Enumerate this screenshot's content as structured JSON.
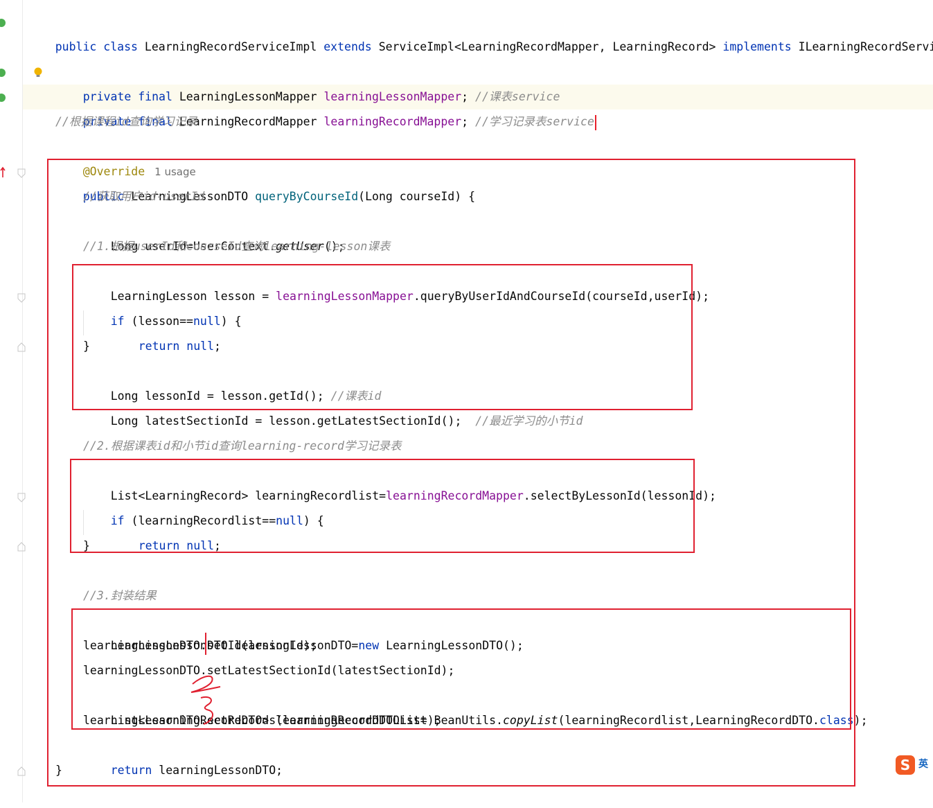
{
  "editor": {
    "class_decl": {
      "public": "public",
      "class": "class",
      "name": "LearningRecordServiceImpl",
      "extends": "extends",
      "parent": "ServiceImpl<LearningRecordMapper, LearningRecord>",
      "implements": "implements",
      "iface": "ILearningRecordService"
    },
    "field1": {
      "mods": "private final",
      "type": "LearningLessonMapper",
      "name": "learningLessonMapper",
      "semi": ";",
      "comment": "//课表service"
    },
    "field2": {
      "mods": "private final",
      "type": "LearningRecordMapper",
      "name": "learningRecordMapper",
      "semi": ";",
      "comment": "//学习记录表service"
    },
    "method_comment": "//根据课程id查询学习记录",
    "annotation": "@Override",
    "usage_hint": "1 usage",
    "method_sig": {
      "public": "public",
      "ret": "LearningLessonDTO",
      "name": "queryByCourseId",
      "params": "(Long courseId) {"
    },
    "c_getuser": "//获取用户id-userId",
    "getuser": {
      "pre": "Long userId=UserContext.",
      "call": "getUser",
      "post": "();"
    },
    "c_step1": "//1.根据userId和courseId查询learning-lesson课表",
    "s1_query": {
      "pre": "LearningLesson lesson = ",
      "field": "learningLessonMapper",
      "post": ".queryByUserIdAndCourseId(courseId,userId);"
    },
    "s1_if": {
      "kw": "if",
      "a": " (lesson==",
      "null": "null",
      "b": ") {"
    },
    "s1_return": {
      "kw": "return",
      "null": "null",
      "semi": ";"
    },
    "brace_close": "}",
    "s1_lessonid": {
      "code": "Long lessonId = lesson.getId(); ",
      "comment": "//课表id"
    },
    "s1_latest": {
      "code": "Long latestSectionId = lesson.getLatestSectionId();  ",
      "comment": "//最近学习的小节id"
    },
    "c_step2": "//2.根据课表id和小节id查询learning-record学习记录表",
    "s2_query": {
      "pre": "List<LearningRecord> learningRecordlist=",
      "field": "learningRecordMapper",
      "post": ".selectByLessonId(lessonId);"
    },
    "s2_if": {
      "kw": "if",
      "a": " (learningRecordlist==",
      "null": "null",
      "b": ") {"
    },
    "s2_return": {
      "kw": "return",
      "null": "null",
      "semi": ";"
    },
    "c_step3": "//3.封装结果",
    "s3_new": {
      "pre": "LearningLessonDTO learningLessonDTO=",
      "kw": "new",
      "post": " LearningLessonDTO();"
    },
    "s3_setid": "learningLessonDTO.setId(lessonId);",
    "s3_setlatest": "learningLessonDTO.setLatestSectionId(latestSectionId);",
    "s3_copy": {
      "pre": "List<LearningRecordDTO> learningRecordDTOList= BeanUtils.",
      "call": "copyList",
      "mid": "(learningRecordlist,LearningRecordDTO.",
      "kw": "class",
      "post": ");"
    },
    "s3_setrecords": "learningLessonDTO.setRecords(learningRecordDTOList);",
    "s_return": {
      "kw": "return",
      "post": " learningLessonDTO;"
    },
    "method_close": "}"
  },
  "ime": {
    "logo": "S",
    "lang": "英"
  },
  "colors": {
    "keyword": "#0033b3",
    "field": "#871094",
    "method": "#00627a",
    "comment": "#8c8c8c",
    "annotation": "#9e880d",
    "highlight_box": "#e02030",
    "caret_line": "#fcfaed"
  }
}
